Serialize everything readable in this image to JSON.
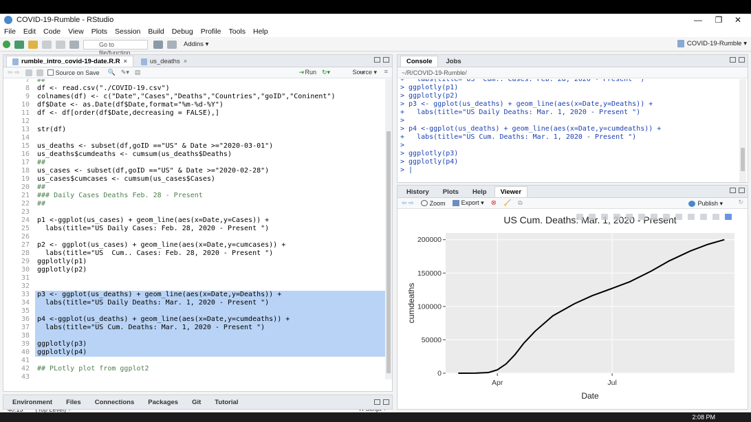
{
  "window": {
    "title": "COVID-19-Rumble - RStudio",
    "controls": {
      "minimize": "—",
      "maximize": "❐",
      "close": "✕"
    }
  },
  "menu": [
    "File",
    "Edit",
    "Code",
    "View",
    "Plots",
    "Session",
    "Build",
    "Debug",
    "Profile",
    "Tools",
    "Help"
  ],
  "toolbar": {
    "goto_placeholder": "Go to file/function",
    "addins": "Addins ▾",
    "project": "COVID-19-Rumble ▾"
  },
  "editor": {
    "tabs": [
      {
        "label": "rumble_intro_covid-19-date.R.R",
        "active": true
      },
      {
        "label": "us_deaths",
        "active": false
      }
    ],
    "source_on_save": "Source on Save",
    "run": "Run",
    "source": "Source ▾",
    "lines": [
      {
        "n": "7",
        "t": "##",
        "comment": true
      },
      {
        "n": "8",
        "t": "df <- read.csv(\"./COVID-19.csv\")"
      },
      {
        "n": "9",
        "t": "colnames(df) <- c(\"Date\",\"Cases\",\"Deaths\",\"Countries\",\"goID\",\"Coninent\")"
      },
      {
        "n": "10",
        "t": "df$Date <- as.Date(df$Date,format=\"%m-%d-%Y\")"
      },
      {
        "n": "11",
        "t": "df <- df[order(df$Date,decreasing = FALSE),]"
      },
      {
        "n": "12",
        "t": ""
      },
      {
        "n": "13",
        "t": "str(df)"
      },
      {
        "n": "14",
        "t": ""
      },
      {
        "n": "15",
        "t": "us_deaths <- subset(df,goID ==\"US\" & Date >=\"2020-03-01\")"
      },
      {
        "n": "16",
        "t": "us_deaths$cumdeaths <- cumsum(us_deaths$Deaths)"
      },
      {
        "n": "17",
        "t": "##",
        "comment": true
      },
      {
        "n": "18",
        "t": "us_cases <- subset(df,goID ==\"US\" & Date >=\"2020-02-28\")"
      },
      {
        "n": "19",
        "t": "us_cases$cumcases <- cumsum(us_cases$Cases)"
      },
      {
        "n": "20",
        "t": "##",
        "comment": true
      },
      {
        "n": "21",
        "t": "### Daily Cases Deaths Feb. 28 - Present",
        "comment": true
      },
      {
        "n": "22",
        "t": "##",
        "comment": true
      },
      {
        "n": "23",
        "t": ""
      },
      {
        "n": "24",
        "t": "p1 <-ggplot(us_cases) + geom_line(aes(x=Date,y=Cases)) +"
      },
      {
        "n": "25",
        "t": "  labs(title=\"US Daily Cases: Feb. 28, 2020 - Present \")"
      },
      {
        "n": "26",
        "t": ""
      },
      {
        "n": "27",
        "t": "p2 <- ggplot(us_cases) + geom_line(aes(x=Date,y=cumcases)) +"
      },
      {
        "n": "28",
        "t": "  labs(title=\"US  Cum.. Cases: Feb. 28, 2020 - Present \")"
      },
      {
        "n": "29",
        "t": "ggplotly(p1)"
      },
      {
        "n": "30",
        "t": "ggplotly(p2)"
      },
      {
        "n": "31",
        "t": ""
      },
      {
        "n": "32",
        "t": ""
      },
      {
        "n": "33",
        "t": "p3 <- ggplot(us_deaths) + geom_line(aes(x=Date,y=Deaths)) +",
        "sel": true
      },
      {
        "n": "34",
        "t": "  labs(title=\"US Daily Deaths: Mar. 1, 2020 - Present \")",
        "sel": true
      },
      {
        "n": "35",
        "t": "",
        "sel": true
      },
      {
        "n": "36",
        "t": "p4 <-ggplot(us_deaths) + geom_line(aes(x=Date,y=cumdeaths)) +",
        "sel": true
      },
      {
        "n": "37",
        "t": "  labs(title=\"US Cum. Deaths: Mar. 1, 2020 - Present \")",
        "sel": true
      },
      {
        "n": "38",
        "t": "",
        "sel": true
      },
      {
        "n": "39",
        "t": "ggplotly(p3)",
        "sel": true
      },
      {
        "n": "40",
        "t": "ggplotly(p4)",
        "sel": true
      },
      {
        "n": "41",
        "t": ""
      },
      {
        "n": "42",
        "t": "## PLotly plot from ggplot2",
        "comment": true
      },
      {
        "n": "43",
        "t": ""
      }
    ],
    "status_pos": "40:13",
    "status_scope": "(Top Level) ÷",
    "status_type": "R Script ÷"
  },
  "bottom_left_tabs": [
    "Environment",
    "Files",
    "Connections",
    "Packages",
    "Git",
    "Tutorial"
  ],
  "console": {
    "tabs": [
      "Console",
      "Jobs"
    ],
    "path": "~/R/COVID-19-Rumble/",
    "lines": [
      "+   labs(title= US  Cum.. Cases: Feb. 28, 2020 - Present  )",
      "> ggplotly(p1)",
      "> ggplotly(p2)",
      "> p3 <- ggplot(us_deaths) + geom_line(aes(x=Date,y=Deaths)) +",
      "+   labs(title=\"US Daily Deaths: Mar. 1, 2020 - Present \")",
      ">",
      "> p4 <-ggplot(us_deaths) + geom_line(aes(x=Date,y=cumdeaths)) +",
      "+   labs(title=\"US Cum. Deaths: Mar. 1, 2020 - Present \")",
      ">",
      "> ggplotly(p3)",
      "> ggplotly(p4)",
      "> |"
    ]
  },
  "viewer": {
    "tabs": [
      "History",
      "Plots",
      "Help",
      "Viewer"
    ],
    "zoom": "Zoom",
    "export": "Export ▾",
    "publish": "Publish ▾"
  },
  "chart_data": {
    "type": "line",
    "title": "US Cum. Deaths: Mar. 1, 2020 - Present",
    "xlabel": "Date",
    "ylabel": "cumdeaths",
    "ylim": [
      0,
      210000
    ],
    "yticks": [
      0,
      50000,
      100000,
      150000,
      200000
    ],
    "ytick_labels": [
      "0",
      "50000",
      "100000",
      "150000",
      "200000"
    ],
    "xticks": [
      "Apr",
      "Jul"
    ],
    "xtick_dates": [
      "2020-04-01",
      "2020-07-01"
    ],
    "xlim": [
      "2020-02-20",
      "2020-10-06"
    ],
    "x": [
      "2020-03-01",
      "2020-03-15",
      "2020-03-25",
      "2020-04-01",
      "2020-04-08",
      "2020-04-15",
      "2020-04-22",
      "2020-05-01",
      "2020-05-15",
      "2020-06-01",
      "2020-06-15",
      "2020-07-01",
      "2020-07-15",
      "2020-08-01",
      "2020-08-15",
      "2020-09-01",
      "2020-09-15",
      "2020-09-28"
    ],
    "y": [
      1,
      60,
      1000,
      5000,
      14000,
      28000,
      45000,
      63000,
      86000,
      104000,
      116000,
      127000,
      137000,
      153000,
      168000,
      183000,
      193000,
      200000
    ],
    "grid": true,
    "line_color": "#000000",
    "panel_color": "#ebebeb"
  },
  "clock": "2:08 PM"
}
